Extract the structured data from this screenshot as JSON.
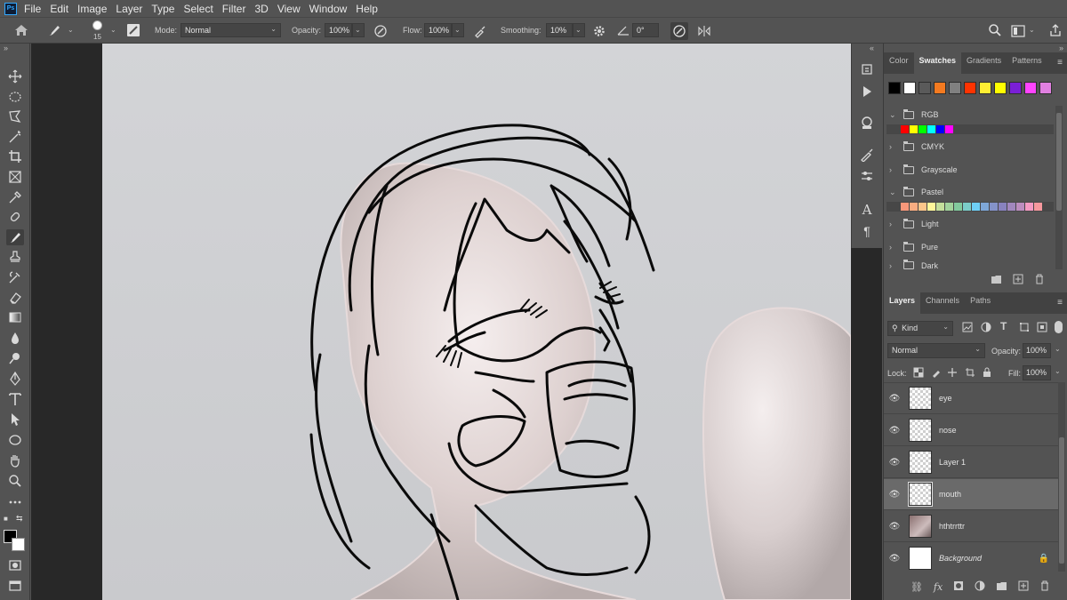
{
  "menu": [
    "File",
    "Edit",
    "Image",
    "Layer",
    "Type",
    "Select",
    "Filter",
    "3D",
    "View",
    "Window",
    "Help"
  ],
  "app_logo": "Ps",
  "options": {
    "brush_size": "15",
    "mode_label": "Mode:",
    "mode_value": "Normal",
    "opacity_label": "Opacity:",
    "opacity_value": "100%",
    "flow_label": "Flow:",
    "flow_value": "100%",
    "smoothing_label": "Smoothing:",
    "smoothing_value": "10%",
    "angle_value": "0°"
  },
  "swatches_panel": {
    "tabs": [
      "Color",
      "Swatches",
      "Gradients",
      "Patterns"
    ],
    "active_tab": "Swatches",
    "recent_colors": [
      "#000000",
      "#ffffff",
      "#5a5a5a",
      "#f47a20",
      "#808080",
      "#ff3300",
      "#ffee33",
      "#ffff00",
      "#7a1fd6",
      "#ff44ff",
      "#e080e0"
    ],
    "groups": [
      {
        "name": "RGB",
        "expanded": true,
        "colors": [
          "#ff0000",
          "#ffff00",
          "#00ff00",
          "#00ffff",
          "#0000ff",
          "#ff00ff"
        ]
      },
      {
        "name": "CMYK",
        "expanded": false,
        "colors": []
      },
      {
        "name": "Grayscale",
        "expanded": false,
        "colors": []
      },
      {
        "name": "Pastel",
        "expanded": true,
        "colors": [
          "#f7977a",
          "#f9ad81",
          "#fdc68a",
          "#fff79a",
          "#c4df9b",
          "#a2d39c",
          "#82ca9d",
          "#7bcdc8",
          "#6ecff6",
          "#7ea7d8",
          "#8493ca",
          "#8882be",
          "#a187be",
          "#bc8dbf",
          "#f49ac2",
          "#f6989d"
        ]
      },
      {
        "name": "Light",
        "expanded": false,
        "colors": []
      },
      {
        "name": "Pure",
        "expanded": false,
        "colors": []
      },
      {
        "name": "Dark",
        "expanded": false,
        "colors": []
      }
    ]
  },
  "layers_panel": {
    "tabs": [
      "Layers",
      "Channels",
      "Paths"
    ],
    "active_tab": "Layers",
    "filter_kind": "Kind",
    "blend_mode": "Normal",
    "opacity_label": "Opacity:",
    "opacity_value": "100%",
    "lock_label": "Lock:",
    "fill_label": "Fill:",
    "fill_value": "100%",
    "layers": [
      {
        "name": "eye",
        "visible": true,
        "selected": false,
        "locked": false
      },
      {
        "name": "nose",
        "visible": true,
        "selected": false,
        "locked": false
      },
      {
        "name": "Layer 1",
        "visible": true,
        "selected": false,
        "locked": false
      },
      {
        "name": "mouth",
        "visible": true,
        "selected": true,
        "locked": false
      },
      {
        "name": "hthtrrttr",
        "visible": true,
        "selected": false,
        "locked": false
      },
      {
        "name": "Background",
        "visible": true,
        "selected": false,
        "locked": true
      }
    ]
  }
}
